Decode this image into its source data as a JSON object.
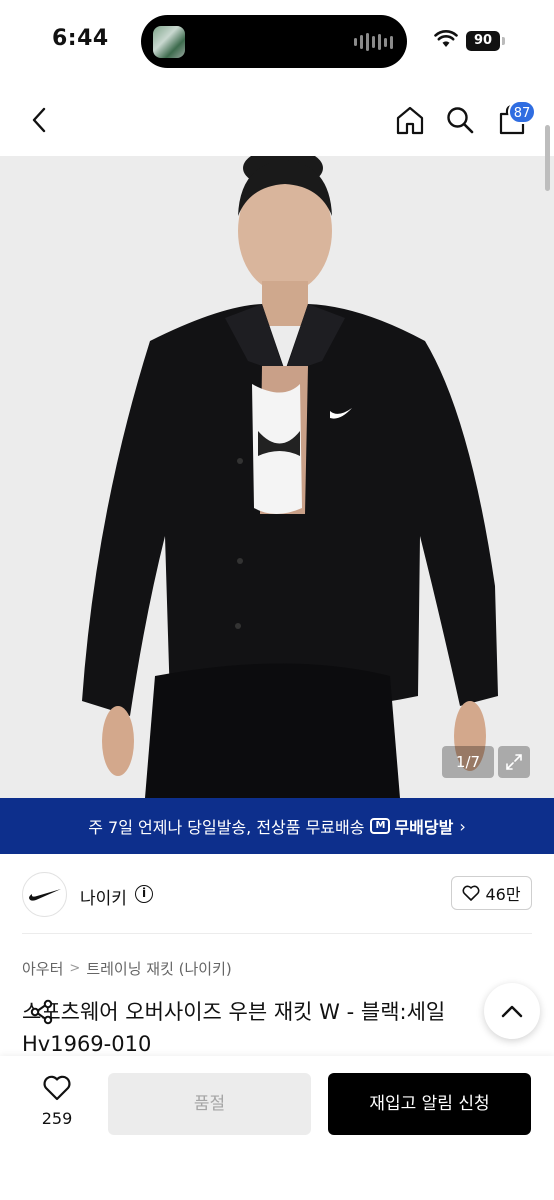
{
  "status": {
    "time": "6:44",
    "battery": "90"
  },
  "header": {
    "cart_count": "87"
  },
  "gallery": {
    "counter": "1/7"
  },
  "banner": {
    "text": "주 7일 언제나 당일발송, 전상품 무료배송",
    "logo_text": "무배당발",
    "logo_box": "M",
    "chevron": "›"
  },
  "brand": {
    "name": "나이키",
    "info": "i",
    "likes": "46만"
  },
  "breadcrumb": {
    "items": [
      "아우터",
      "트레이닝 재킷 (나이키)"
    ],
    "separator": ">"
  },
  "product": {
    "title_line1": "스포츠웨어 오버사이즈 우븐 재킷 W - 블랙:세일",
    "title_line2": "Hv1969-010"
  },
  "bottom": {
    "wish_count": "259",
    "soldout_label": "품절",
    "restock_label": "재입고 알림 신청"
  },
  "colors": {
    "banner_bg": "#0d2f8c",
    "badge_bg": "#2f6de1",
    "primary_btn": "#000000"
  }
}
